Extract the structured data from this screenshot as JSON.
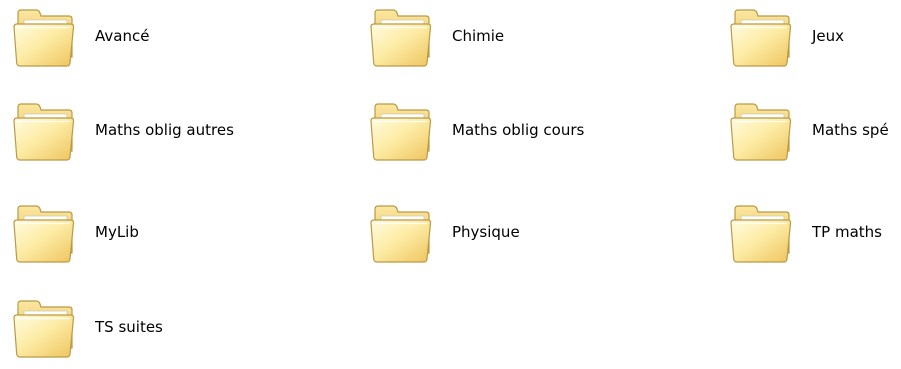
{
  "folders": [
    {
      "name": "Avancé",
      "icon": "folder-icon"
    },
    {
      "name": "Chimie",
      "icon": "folder-icon"
    },
    {
      "name": "Jeux",
      "icon": "folder-icon"
    },
    {
      "name": "Maths oblig autres",
      "icon": "folder-icon"
    },
    {
      "name": "Maths oblig cours",
      "icon": "folder-icon"
    },
    {
      "name": "Maths spé",
      "icon": "folder-icon"
    },
    {
      "name": "MyLib",
      "icon": "folder-icon"
    },
    {
      "name": "Physique",
      "icon": "folder-icon"
    },
    {
      "name": "TP maths",
      "icon": "folder-icon"
    },
    {
      "name": "TS suites",
      "icon": "folder-icon"
    }
  ],
  "colors": {
    "folder_body_light": "#fff7c8",
    "folder_body_dark": "#f0cf70",
    "folder_outline": "#b99a45",
    "label_text": "#000000",
    "background": "#ffffff"
  }
}
